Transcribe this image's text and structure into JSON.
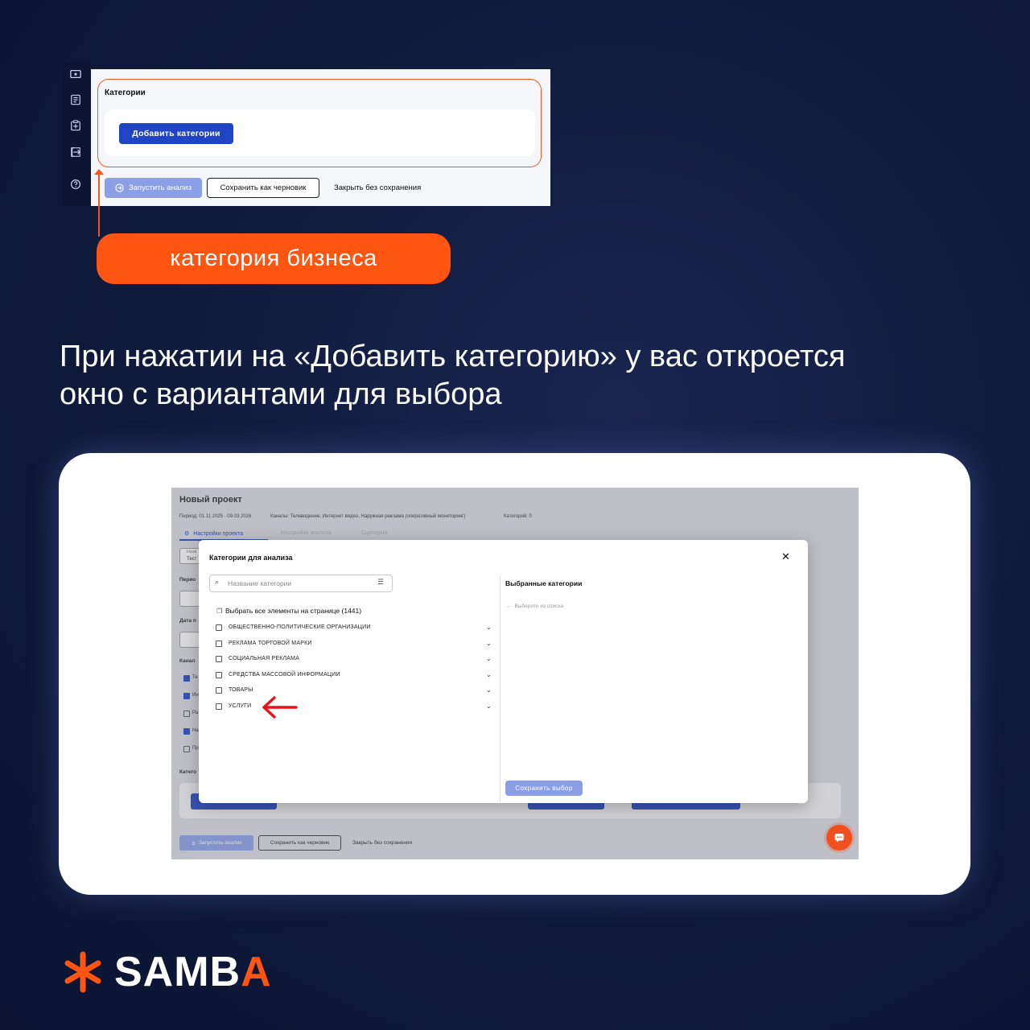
{
  "top_screenshot": {
    "categories_title": "Категории",
    "add_categories_button": "Добавить категории",
    "run_analysis_button": "Запустить анализ",
    "save_draft_button": "Сохранить как черновик",
    "close_no_save": "Закрыть без сохранения",
    "rail_icons": [
      "ticket-icon",
      "document-icon",
      "clipboard-icon",
      "exit-icon",
      "help-icon"
    ]
  },
  "callout": {
    "label": "категория бизнеса"
  },
  "headline": {
    "line1": "При нажатии на «Добавить категорию» у вас откроется",
    "line2": "окно с вариантами для выбора"
  },
  "background_app": {
    "title": "Новый проект",
    "meta_period": "Период: 01.11.2025 - 09.03.2026",
    "meta_channels": "Каналы: Телевидение, Интернет видео, Наружная реклама (оперативный мониторинг)",
    "meta_categories": "Категорий: 0",
    "tab_active": "Настройки проекта",
    "tab_2": "Настройки анализа",
    "tab_3": "Сценарии",
    "field_fragments": [
      "Назв",
      "Тест",
      "Перио",
      "Дата п",
      "Канал",
      "Те",
      "Ин",
      "Ра",
      "На",
      "Пр",
      "Катего"
    ],
    "run_analysis_button": "Запустить анализ",
    "save_draft_button": "Сохранить как черновик",
    "close_no_save": "Закрыть без сохранения"
  },
  "modal": {
    "title": "Категории для анализа",
    "search_placeholder": "Название категории",
    "select_all": "Выбрать все элементы на странице (1441)",
    "categories": [
      "ОБЩЕСТВЕННО-ПОЛИТИЧЕСКИЕ ОРГАНИЗАЦИИ",
      "РЕКЛАМА ТОРГОВОЙ МАРКИ",
      "СОЦИАЛЬНАЯ РЕКЛАМА",
      "СРЕДСТВА МАССОВОЙ ИНФОРМАЦИИ",
      "ТОВАРЫ",
      "УСЛУГИ"
    ],
    "selected_title": "Выбранные категории",
    "selected_hint": "Выберите из списка",
    "save_selection_button": "Сохранить выбор"
  },
  "brand": {
    "logo_main": "SAMB",
    "logo_accent": "A"
  },
  "colors": {
    "accent_orange": "#fe5512",
    "primary_blue": "#1f44c4",
    "disabled_blue": "#8a9fe6",
    "background": "#101a3c"
  }
}
